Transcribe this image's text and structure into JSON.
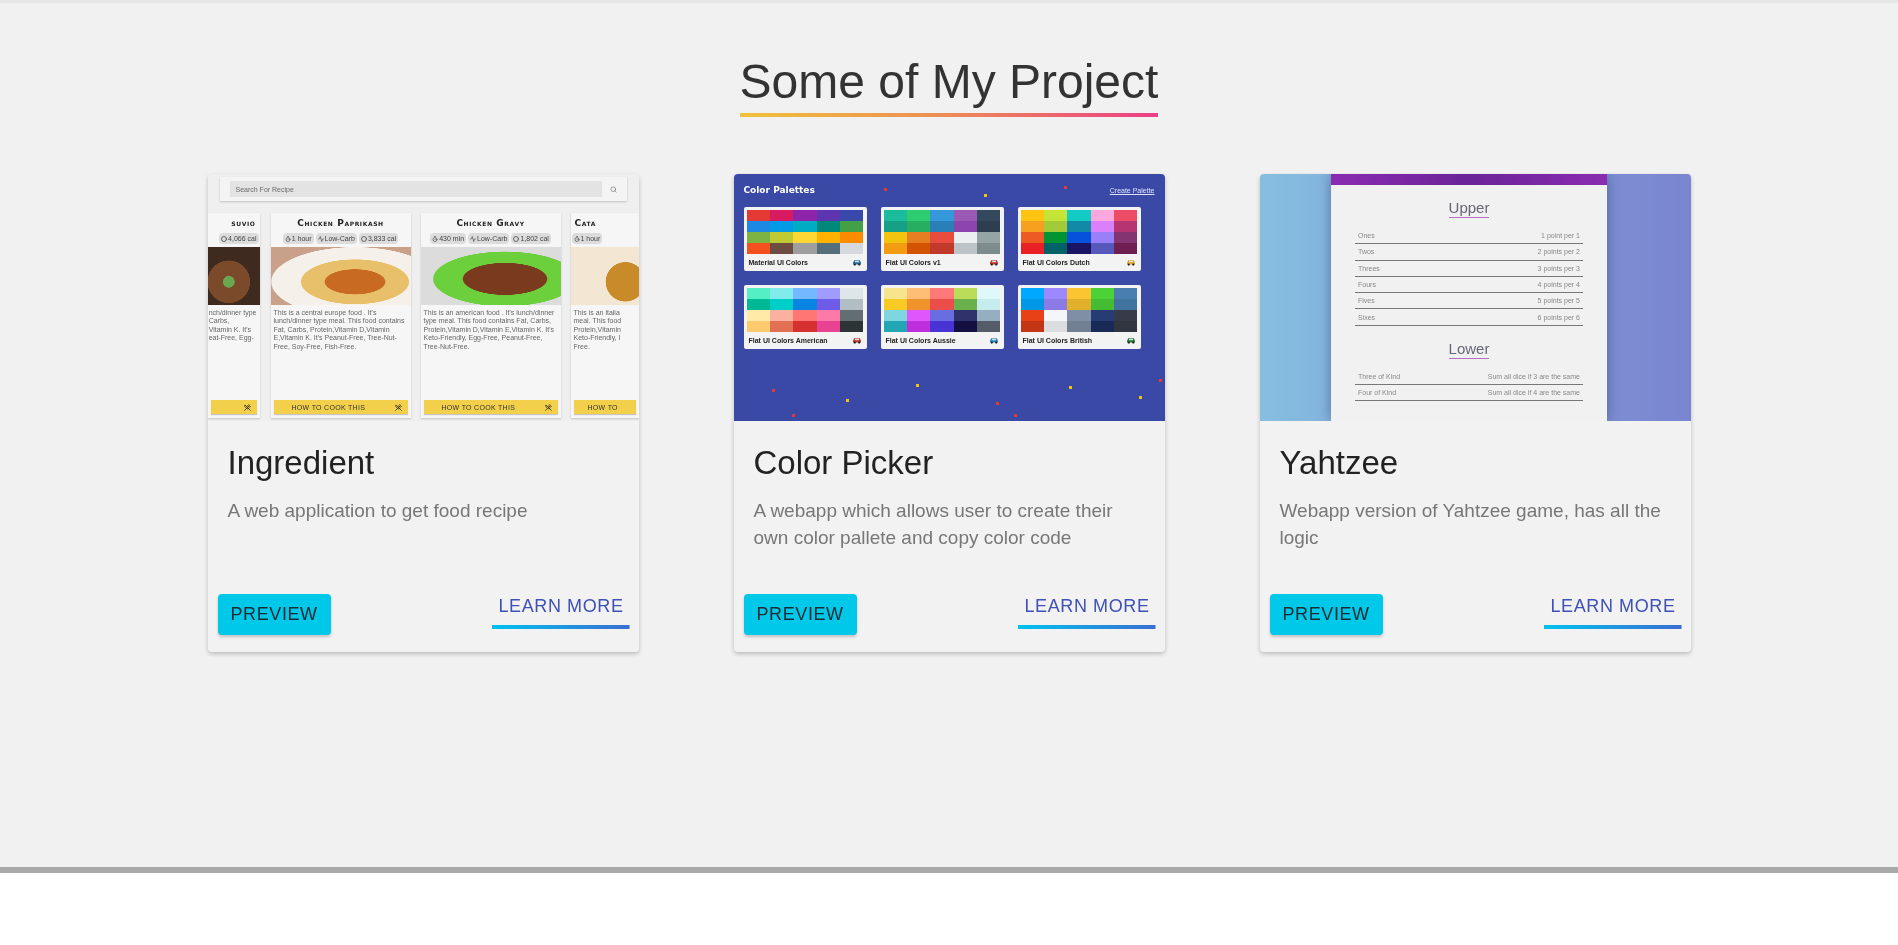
{
  "header": {
    "title": "Some of My Project"
  },
  "projects": [
    {
      "kind": "recipe",
      "title": "Ingredient",
      "description": "A web application to get food recipe",
      "preview": "PREVIEW",
      "learn_more": "LEARN MORE",
      "screenshot": {
        "search_placeholder": "Search For Recipe",
        "recipes": [
          {
            "kind": "left_edge",
            "name": "suvio",
            "tags": [
              {
                "kind": "calories",
                "label": "4,066 cal"
              }
            ],
            "description_lines": [
              "nch/dinner type",
              "Carbs,",
              "Vitamin K. It's",
              "eat-Free, Egg-"
            ]
          },
          {
            "kind": "full",
            "name": "Chicken Paprikash",
            "tags": [
              {
                "kind": "time",
                "label": "1 hour"
              },
              {
                "kind": "diet",
                "label": "Low-Carb"
              },
              {
                "kind": "calories",
                "label": "3,833 cal"
              }
            ],
            "description_lines": [
              "This is a central europe food . It's lunch/dinner type meal. This food contains Fat, Carbs, Protein,Vitamin D,Vitamin E,Vitamin K. It's Peanut-Free, Tree-Nut-Free, Soy-Free, Fish-Free."
            ],
            "button": "HOW TO COOK THIS"
          },
          {
            "kind": "full",
            "name": "Chicken Gravy",
            "tags": [
              {
                "kind": "time",
                "label": "430 min"
              },
              {
                "kind": "diet",
                "label": "Low-Carb"
              },
              {
                "kind": "calories",
                "label": "1,802 cal"
              }
            ],
            "description_lines": [
              "This is an american food . It's lunch/dinner type meal. This food contains Fat, Carbs, Protein,Vitamin D,Vitamin E,Vitamin K. It's Keto-Friendly, Egg-Free, Peanut-Free, Tree-Nut-Free."
            ],
            "button": "HOW TO COOK THIS"
          },
          {
            "kind": "right_edge",
            "name": "Cata",
            "tags": [
              {
                "kind": "time",
                "label": "1 hour"
              }
            ],
            "description_lines": [
              "This is an italia",
              "meal. This food",
              "Protein,Vitamin",
              "Keto-Friendly, I",
              "Free."
            ],
            "button": "HOW TO"
          }
        ]
      }
    },
    {
      "kind": "palettes",
      "title": "Color Picker",
      "description": "A webapp which allows user to create their own color pallete and copy color code",
      "preview": "PREVIEW",
      "learn_more": "LEARN MORE",
      "screenshot": {
        "heading": "Color Palettes",
        "link": "Create Palette",
        "palettes": [
          "Material UI Colors",
          "Flat UI Colors v1",
          "Flat UI Colors Dutch",
          "Flat UI Colors American",
          "Flat UI Colors Aussie",
          "Flat UI Colors British"
        ]
      }
    },
    {
      "kind": "scoreboard",
      "title": "Yahtzee",
      "description": "Webapp version of Yahtzee game, has all the logic",
      "preview": "PREVIEW",
      "learn_more": "LEARN MORE",
      "screenshot": {
        "sections": [
          {
            "title": "Upper",
            "rows": [
              {
                "name": "Ones",
                "rule": "1 point per 1"
              },
              {
                "name": "Twos",
                "rule": "2 points per 2"
              },
              {
                "name": "Threes",
                "rule": "3 points per 3"
              },
              {
                "name": "Fours",
                "rule": "4 points per 4"
              },
              {
                "name": "Fives",
                "rule": "5 points per 5"
              },
              {
                "name": "Sixes",
                "rule": "6 points per 6"
              }
            ]
          },
          {
            "title": "Lower",
            "rows": [
              {
                "name": "Three of Kind",
                "rule": "Sum all dice if 3 are the same"
              },
              {
                "name": "Four of Kind",
                "rule": "Sum all dice if 4 are the same"
              }
            ]
          }
        ]
      }
    }
  ]
}
